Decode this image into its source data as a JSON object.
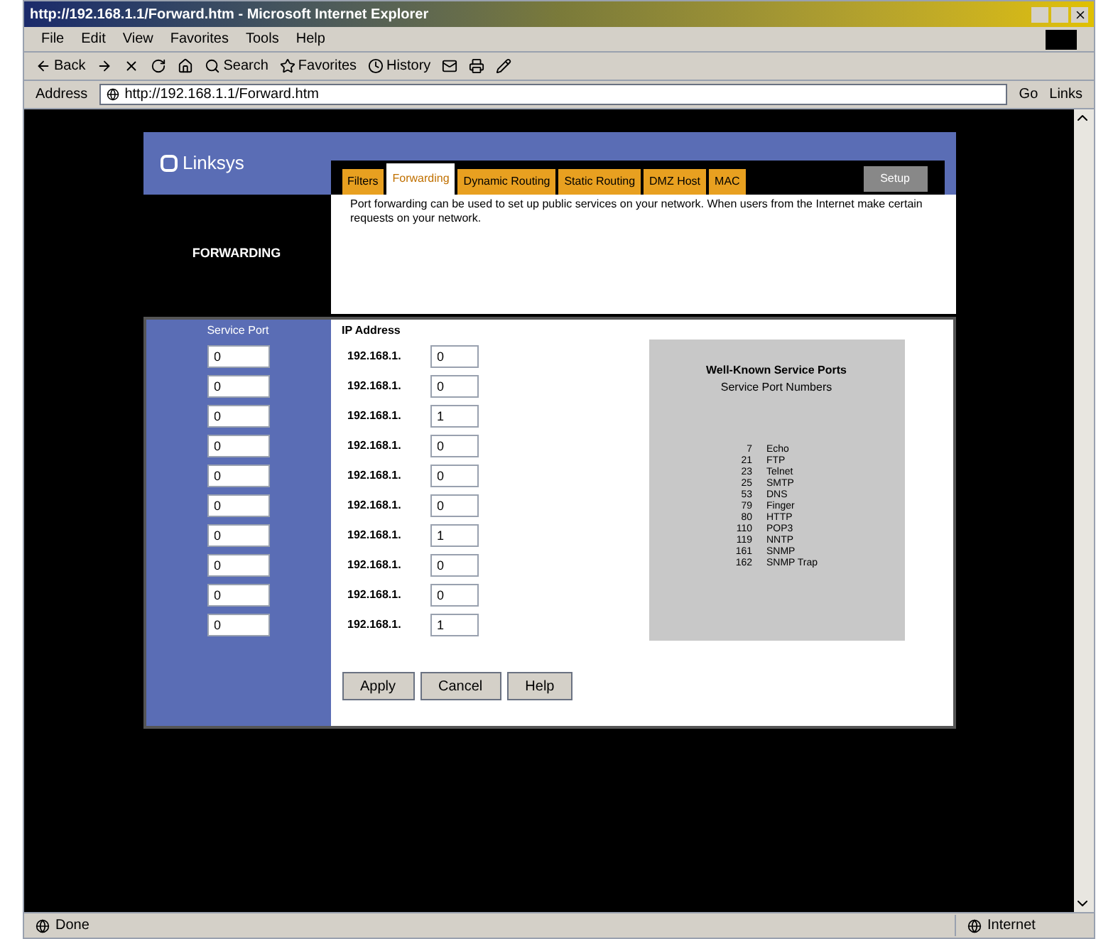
{
  "window": {
    "title": "http://192.168.1.1/Forward.htm - Microsoft Internet Explorer"
  },
  "menu": [
    "File",
    "Edit",
    "View",
    "Favorites",
    "Tools",
    "Help"
  ],
  "toolbar": [
    {
      "kind": "back",
      "label": "Back"
    },
    {
      "kind": "forward"
    },
    {
      "kind": "stop"
    },
    {
      "kind": "refresh"
    },
    {
      "kind": "home"
    },
    {
      "kind": "search",
      "label": "Search"
    },
    {
      "kind": "favorites",
      "label": "Favorites"
    },
    {
      "kind": "history",
      "label": "History"
    },
    {
      "kind": "mail"
    },
    {
      "kind": "print"
    },
    {
      "kind": "edit"
    }
  ],
  "address": {
    "label": "Address",
    "value": "http://192.168.1.1/Forward.htm",
    "go": "Go",
    "links": "Links"
  },
  "router": {
    "logo": "Linksys",
    "tabs": [
      {
        "label": "Filters",
        "selected": false
      },
      {
        "label": "Forwarding",
        "selected": true
      },
      {
        "label": "Dynamic Routing",
        "selected": false
      },
      {
        "label": "Static Routing",
        "selected": false
      },
      {
        "label": "DMZ Host",
        "selected": false
      },
      {
        "label": "MAC",
        "selected": false
      }
    ],
    "setup_button": "Setup",
    "section": "FORWARDING",
    "description": "Port forwarding can be used to set up public services on your network. When users from the Internet make certain requests on your network.",
    "columns": [
      "Service Port",
      "IP Address"
    ],
    "rows": [
      {
        "port": "0",
        "prefix": "192.168.1.",
        "ip": "0"
      },
      {
        "port": "0",
        "prefix": "192.168.1.",
        "ip": "0"
      },
      {
        "port": "0",
        "prefix": "192.168.1.",
        "ip": "1"
      },
      {
        "port": "0",
        "prefix": "192.168.1.",
        "ip": "0"
      },
      {
        "port": "0",
        "prefix": "192.168.1.",
        "ip": "0"
      },
      {
        "port": "0",
        "prefix": "192.168.1.",
        "ip": "0"
      },
      {
        "port": "0",
        "prefix": "192.168.1.",
        "ip": "1"
      },
      {
        "port": "0",
        "prefix": "192.168.1.",
        "ip": "0"
      },
      {
        "port": "0",
        "prefix": "192.168.1.",
        "ip": "0"
      },
      {
        "port": "0",
        "prefix": "192.168.1.",
        "ip": "1"
      }
    ],
    "buttons": [
      "Apply",
      "Cancel",
      "Help"
    ],
    "ports_box": {
      "title": "Well-Known Service Ports",
      "subtitle": "Service Port Numbers",
      "items": [
        {
          "number": "7",
          "name": "Echo"
        },
        {
          "number": "21",
          "name": "FTP"
        },
        {
          "number": "23",
          "name": "Telnet"
        },
        {
          "number": "25",
          "name": "SMTP"
        },
        {
          "number": "53",
          "name": "DNS"
        },
        {
          "number": "79",
          "name": "Finger"
        },
        {
          "number": "80",
          "name": "HTTP"
        },
        {
          "number": "110",
          "name": "POP3"
        },
        {
          "number": "119",
          "name": "NNTP"
        },
        {
          "number": "161",
          "name": "SNMP"
        },
        {
          "number": "162",
          "name": "SNMP Trap"
        }
      ]
    }
  },
  "status_bar": {
    "text": "Done",
    "zone": "Internet"
  }
}
